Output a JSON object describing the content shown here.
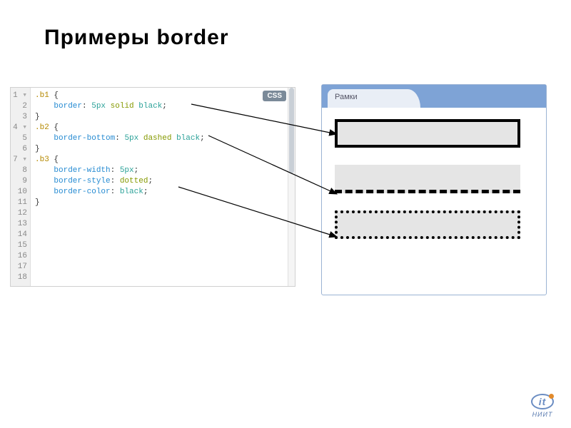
{
  "title": "Примеры border",
  "editor": {
    "badge": "CSS",
    "lines": [
      "1",
      "2",
      "3",
      "4",
      "5",
      "6",
      "7",
      "8",
      "9",
      "10",
      "11",
      "12",
      "13",
      "14",
      "15",
      "16",
      "17",
      "18"
    ],
    "fold_marks": {
      "1": "▾",
      "4": "▾",
      "7": "▾"
    },
    "code": {
      "r1_sel": ".b1",
      "r1_open": " {",
      "r2_prop": "border",
      "r2_val_num": "5px",
      "r2_val_kw": "solid",
      "r2_val_color": "black",
      "r3_close": "}",
      "r4_sel": ".b2",
      "r4_open": " {",
      "r5_prop": "border-bottom",
      "r5_val_num": "5px",
      "r5_val_kw": "dashed",
      "r5_val_color": "black",
      "r6_close": "}",
      "r7_sel": ".b3",
      "r7_open": " {",
      "r8_prop": "border-width",
      "r8_val": "5px",
      "r9_prop": "border-style",
      "r9_val": "dotted",
      "r10_prop": "border-color",
      "r10_val": "black",
      "r11_close": "}"
    }
  },
  "preview": {
    "tab_label": "Рамки"
  },
  "logo": {
    "mono": "it",
    "text": "НИИТ"
  }
}
